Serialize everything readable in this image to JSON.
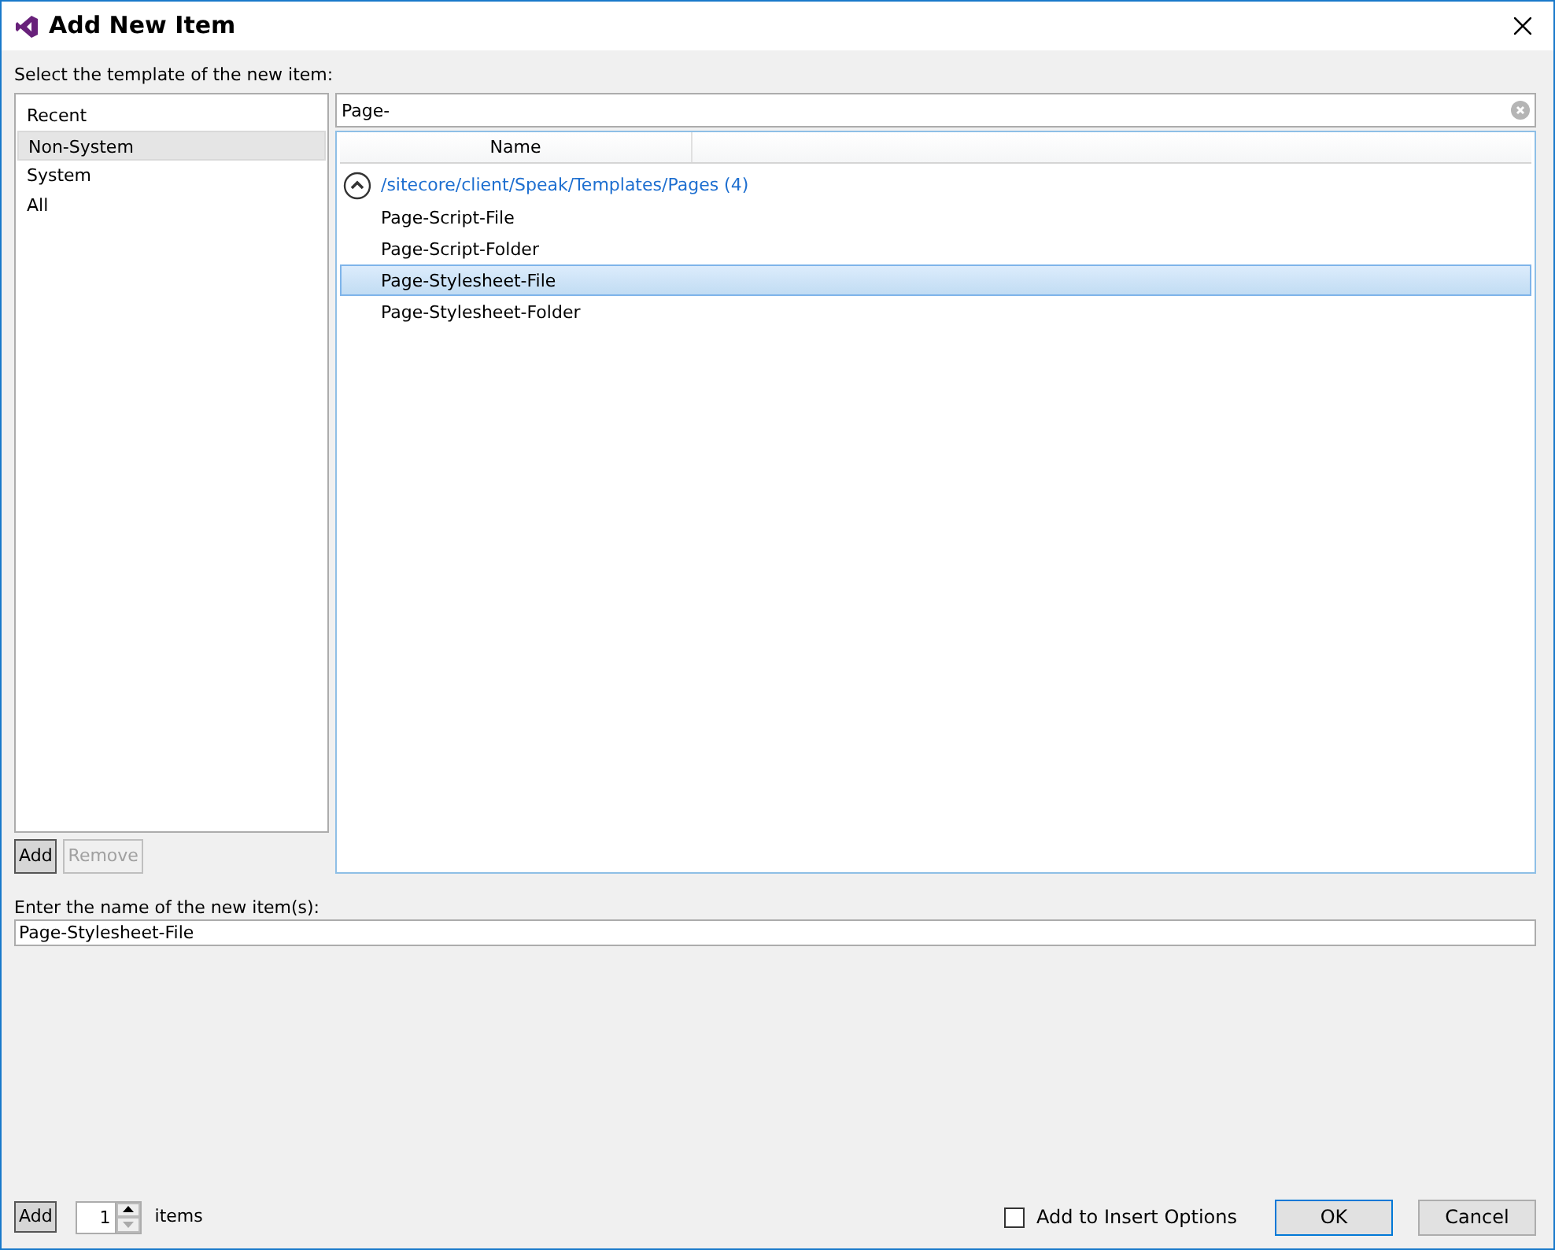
{
  "window": {
    "title": "Add New Item"
  },
  "template_label": "Select the template of the new item:",
  "categories": [
    {
      "label": "Recent",
      "selected": false
    },
    {
      "label": "Non-System",
      "selected": true
    },
    {
      "label": "System",
      "selected": false
    },
    {
      "label": "All",
      "selected": false
    }
  ],
  "category_buttons": [
    {
      "label": "Add",
      "disabled": false
    },
    {
      "label": "Remove",
      "disabled": true
    }
  ],
  "search": {
    "value": "Page-"
  },
  "columns": [
    "Name"
  ],
  "group": {
    "path": "/sitecore/client/Speak/Templates/Pages (4)",
    "expanded": true
  },
  "templates": [
    {
      "label": "Page-Script-File",
      "selected": false
    },
    {
      "label": "Page-Script-Folder",
      "selected": false
    },
    {
      "label": "Page-Stylesheet-File",
      "selected": true
    },
    {
      "label": "Page-Stylesheet-Folder",
      "selected": false
    }
  ],
  "name_label": "Enter the name of the new item(s):",
  "name_value": "Page-Stylesheet-File",
  "footer": {
    "add": "Add",
    "count": "1",
    "count_label": "items",
    "insert_option": {
      "label": "Add to Insert Options",
      "checked": false
    },
    "ok": "OK",
    "cancel": "Cancel"
  }
}
